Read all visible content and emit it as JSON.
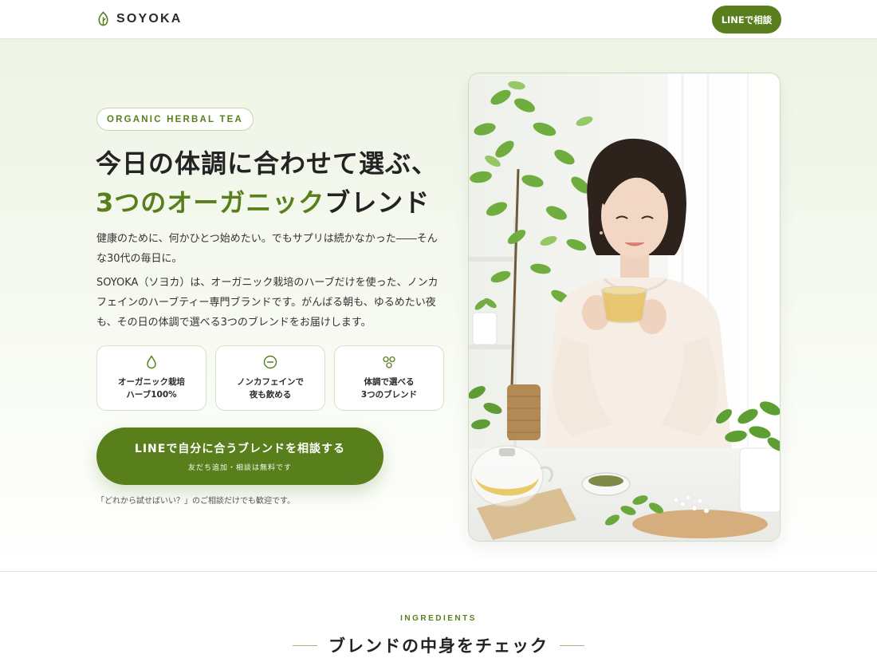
{
  "header": {
    "logo_text": "SOYOKA",
    "line_button": "LINEで相談"
  },
  "hero": {
    "eyebrow": "ORGANIC HERBAL TEA",
    "headline_line1": "今日の体調に合わせて選ぶ、",
    "headline_accent": "3つのオーガニック",
    "headline_rest": "ブレンド",
    "lead1": "健康のために、何かひとつ始めたい。でもサプリは続かなかった――そんな30代の毎日に。",
    "lead2": "SOYOKA（ソヨカ）は、オーガニック栽培のハーブだけを使った、ノンカフェインのハーブティー専門ブランドです。がんばる朝も、ゆるめたい夜も、その日の体調で選べる3つのブレンドをお届けします。",
    "features": [
      {
        "icon": "drop-icon",
        "label": "オーガニック栽培\nハーブ100%"
      },
      {
        "icon": "minus-circle-icon",
        "label": "ノンカフェインで\n夜も飲める"
      },
      {
        "icon": "three-circles-icon",
        "label": "体調で選べる\n3つのブレンド"
      }
    ],
    "cta_main": "LINEで自分に合うブレンドを相談する",
    "cta_sub": "友だち追加・相談は無料です",
    "note": "「どれから試せばいい？」のご相談だけでも歓迎です。"
  },
  "ingredients": {
    "eyebrow": "INGREDIENTS",
    "title": "ブレンドの中身をチェック"
  },
  "colors": {
    "accent": "#587f1b",
    "hero_bg": "#eef4e5",
    "border": "#d7e2c9"
  }
}
